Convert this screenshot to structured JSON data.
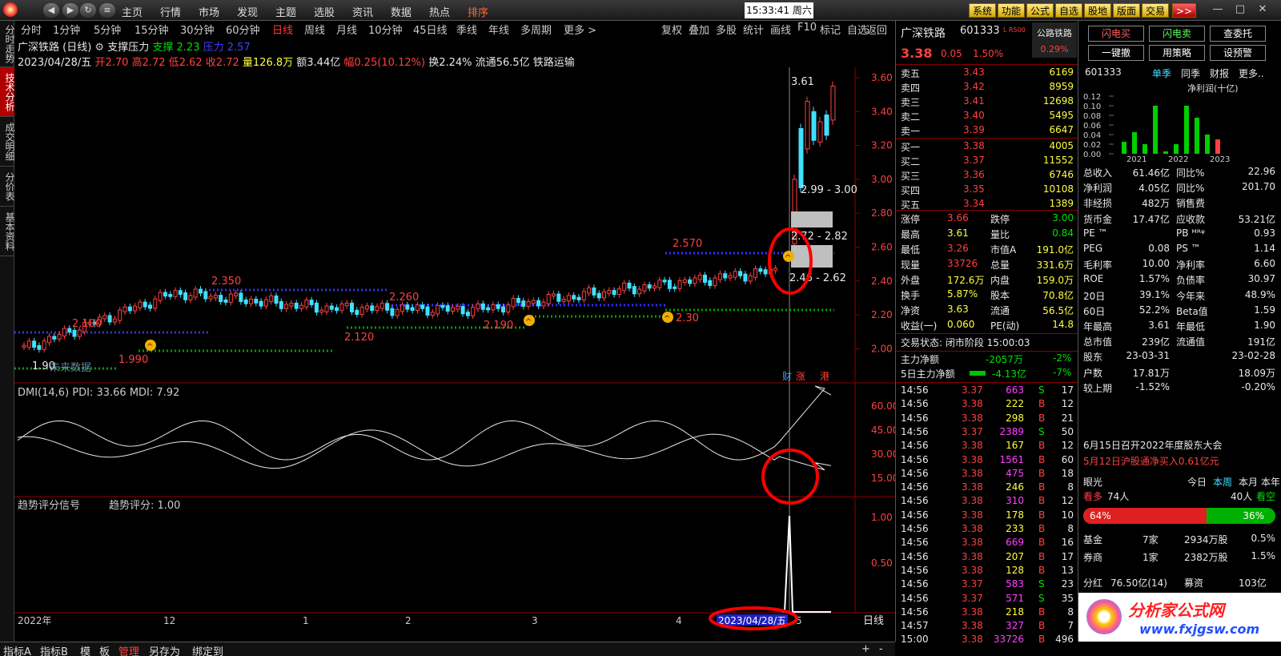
{
  "top_nav": {
    "back": "◀",
    "forward": "▶",
    "refresh": "↻",
    "menu": [
      "主页",
      "行情",
      "市场",
      "发现",
      "主题",
      "选股",
      "资讯",
      "数据",
      "热点",
      "排序"
    ],
    "active_menu": "排序",
    "clock": "15:33:41 周六",
    "right_buttons": [
      "系统",
      "功能",
      "公式",
      "自选",
      "股地",
      "版面",
      "交易"
    ],
    "more": ">>"
  },
  "left_tabs": [
    "分时走势",
    "技术分析",
    "成交明细",
    "分价表",
    "基本资料"
  ],
  "period_tabs": [
    "分时",
    "1分钟",
    "5分钟",
    "15分钟",
    "30分钟",
    "60分钟",
    "日线",
    "周线",
    "月线",
    "10分钟",
    "45日线",
    "季线",
    "年线",
    "多周期",
    "更多 >"
  ],
  "active_period": "日线",
  "chart_tools": [
    "复权",
    "叠加",
    "多股",
    "统计",
    "画线",
    "F10",
    "标记",
    "自选",
    "返回"
  ],
  "stock_title": "广深铁路 (日线)",
  "indicator_name": "支撑压力",
  "support_label": "支撑",
  "support_value": "2.23",
  "pressure_label": "压力",
  "pressure_value": "2.57",
  "info_line": {
    "date": "2023/04/28/五",
    "open_label": "开",
    "open": "2.70",
    "high_label": "高",
    "high": "2.72",
    "low_label": "低",
    "low": "2.62",
    "close_label": "收",
    "close": "2.72",
    "volume_label": "量",
    "volume": "126.8万",
    "amount_label": "额",
    "amount": "3.44亿",
    "change_label": "幅",
    "change": "0.25(10.12%)",
    "turnover_label": "换",
    "turnover": "2.24%",
    "float_label": "流通",
    "float": "56.5亿",
    "sector": "铁路运输"
  },
  "chart_annotations": {
    "price_labels": [
      "2.100",
      "1.990",
      "2.350",
      "2.120",
      "2.260",
      "2.190",
      "2.570",
      "2.30",
      "3.61"
    ],
    "zones": [
      "2.99 - 3.00",
      "2.72 - 2.82",
      "2.46 - 2.62"
    ],
    "origin_label": "1.90",
    "future_label": "未来数据",
    "event_labels": [
      "财",
      "涨",
      "港"
    ],
    "sel_date": "2023/04/28/五",
    "period_label": "日线",
    "x_ticks": [
      "2022年",
      "12",
      "1",
      "2",
      "3",
      "4",
      "5"
    ]
  },
  "price_axis": [
    "3.60",
    "3.40",
    "3.20",
    "3.00",
    "2.80",
    "2.60",
    "2.40",
    "2.20",
    "2.00"
  ],
  "dmi_title": "DMI(14,6) PDI: 33.66 MDI: 7.92",
  "dmi_axis": [
    "60.00",
    "45.00",
    "30.00",
    "15.00"
  ],
  "trend_title_a": "趋势评分信号",
  "trend_title_b": "趋势评分: 1.00",
  "trend_axis": [
    "1.00",
    "0.50"
  ],
  "chart_data": [
    {
      "type": "line",
      "title": "支撑压力 daily candlestick (close approx.)",
      "x": [
        "2022-11",
        "2022-12",
        "2023-01",
        "2023-02",
        "2023-03",
        "2023-04",
        "2023-04-28"
      ],
      "series": [
        {
          "name": "close",
          "values": [
            2.0,
            2.33,
            2.24,
            2.23,
            2.35,
            2.46,
            2.72
          ]
        }
      ],
      "ylabel": "",
      "ylim": [
        1.9,
        3.65
      ]
    },
    {
      "type": "line",
      "title": "DMI(14,6)",
      "series": [
        {
          "name": "PDI",
          "values": [
            33.66
          ]
        },
        {
          "name": "MDI",
          "values": [
            7.92
          ]
        }
      ],
      "ylim": [
        0,
        65
      ]
    },
    {
      "type": "line",
      "title": "趋势评分信号",
      "series": [
        {
          "name": "趋势评分",
          "values": [
            1.0
          ]
        }
      ],
      "ylim": [
        0,
        1.1
      ]
    }
  ],
  "quote": {
    "name": "广深铁路",
    "code": "601333",
    "tag": "L R500",
    "sector": "公路铁路",
    "sector_pct": "0.29%",
    "price": "3.38",
    "chg": "0.05",
    "pct": "1.50%",
    "asks": [
      [
        "卖五",
        "3.43",
        "6169"
      ],
      [
        "卖四",
        "3.42",
        "8959"
      ],
      [
        "卖三",
        "3.41",
        "12698"
      ],
      [
        "卖二",
        "3.40",
        "5495"
      ],
      [
        "卖一",
        "3.39",
        "6647"
      ]
    ],
    "bids": [
      [
        "买一",
        "3.38",
        "4005"
      ],
      [
        "买二",
        "3.37",
        "11552"
      ],
      [
        "买三",
        "3.36",
        "6746"
      ],
      [
        "买四",
        "3.35",
        "10108"
      ],
      [
        "买五",
        "3.34",
        "1389"
      ]
    ],
    "stats": [
      [
        "涨停",
        "3.66",
        "跌停",
        "3.00"
      ],
      [
        "最高",
        "3.61",
        "量比",
        "0.84"
      ],
      [
        "最低",
        "3.26",
        "市值A",
        "191.0亿"
      ],
      [
        "现量",
        "33726",
        "总量",
        "331.6万"
      ],
      [
        "外盘",
        "172.6万",
        "内盘",
        "159.0万"
      ],
      [
        "换手",
        "5.87%",
        "股本",
        "70.8亿"
      ],
      [
        "净资",
        "3.63",
        "流通",
        "56.5亿"
      ],
      [
        "收益(一)",
        "0.060",
        "PE(动)",
        "14.8"
      ]
    ],
    "status": "交易状态: 闭市阶段 15:00:03",
    "main_flow_label": "主力净额",
    "main_flow": "-2057万",
    "main_flow_pct": "-2%",
    "flow5_label": "5日主力净额",
    "flow5": "-4.13亿",
    "flow5_pct": "-7%",
    "ticks": [
      [
        "14:56",
        "3.37",
        "663",
        "S",
        "17"
      ],
      [
        "14:56",
        "3.38",
        "222",
        "B",
        "12"
      ],
      [
        "14:56",
        "3.38",
        "298",
        "B",
        "21"
      ],
      [
        "14:56",
        "3.37",
        "2389",
        "S",
        "50"
      ],
      [
        "14:56",
        "3.38",
        "167",
        "B",
        "12"
      ],
      [
        "14:56",
        "3.38",
        "1561",
        "B",
        "60"
      ],
      [
        "14:56",
        "3.38",
        "475",
        "B",
        "18"
      ],
      [
        "14:56",
        "3.38",
        "246",
        "B",
        "8"
      ],
      [
        "14:56",
        "3.38",
        "310",
        "B",
        "12"
      ],
      [
        "14:56",
        "3.38",
        "178",
        "B",
        "10"
      ],
      [
        "14:56",
        "3.38",
        "233",
        "B",
        "8"
      ],
      [
        "14:56",
        "3.38",
        "669",
        "B",
        "16"
      ],
      [
        "14:56",
        "3.38",
        "207",
        "B",
        "17"
      ],
      [
        "14:56",
        "3.38",
        "128",
        "B",
        "13"
      ],
      [
        "14:56",
        "3.37",
        "583",
        "S",
        "23"
      ],
      [
        "14:56",
        "3.37",
        "571",
        "S",
        "35"
      ],
      [
        "14:56",
        "3.38",
        "218",
        "B",
        "8"
      ],
      [
        "14:57",
        "3.38",
        "327",
        "B",
        "7"
      ],
      [
        "15:00",
        "3.38",
        "33726",
        "B",
        "496"
      ]
    ]
  },
  "f10": {
    "btns": [
      "闪电买",
      "闪电卖",
      "查委托",
      "一键撤",
      "用策略",
      "设预警"
    ],
    "code": "601333",
    "tabs": [
      "单季",
      "同季",
      "财报",
      "更多.."
    ],
    "chart_title": "净利润(十亿)",
    "y_ticks": [
      "0.12",
      "0.10",
      "0.08",
      "0.06",
      "0.04",
      "0.02",
      "0.00"
    ],
    "years": [
      "2021",
      "2022",
      "2023"
    ],
    "bar_values": [
      0.025,
      0.045,
      0.02,
      0.1,
      0.005,
      0.02,
      0.1,
      0.075,
      0.04,
      0.03
    ],
    "rows": [
      [
        "总收入",
        "61.46亿",
        "同比%",
        "22.96"
      ],
      [
        "净利润",
        "4.05亿",
        "同比%",
        "201.70"
      ],
      [
        "非经损",
        "482万",
        "销售费",
        ""
      ],
      [
        "货币金",
        "17.47亿",
        "应收款",
        "53.21亿"
      ],
      [
        "PE ™",
        "",
        "PB ᴹᴿᵠ",
        "0.93"
      ],
      [
        "PEG",
        "0.08",
        "PS ™",
        "1.14"
      ],
      [
        "毛利率",
        "10.00",
        "净利率",
        "6.60"
      ],
      [
        "ROE",
        "1.57%",
        "负债率",
        "30.97"
      ],
      [
        "20日",
        "39.1%",
        "今年来",
        "48.9%"
      ],
      [
        "60日",
        "52.2%",
        "Beta值",
        "1.59"
      ],
      [
        "年最高",
        "3.61",
        "年最低",
        "1.90"
      ],
      [
        "总市值",
        "239亿",
        "流通值",
        "191亿"
      ],
      [
        "股东",
        "23-03-31",
        "",
        "23-02-28"
      ],
      [
        "户数",
        "17.81万",
        "",
        "18.09万"
      ],
      [
        "较上期",
        "-1.52%",
        "",
        "-0.20%"
      ]
    ],
    "news1": "6月15日召开2022年度股东大会",
    "news2": "5月12日沪股通净买入0.61亿元",
    "eye_label": "眼光",
    "eye_tabs": [
      "今日",
      "本周",
      "本月",
      "本年"
    ],
    "bull_label": "看多",
    "bull_count": "74人",
    "bear_count": "40人",
    "bear_label": "看空",
    "bull_pct": "64%",
    "bear_pct": "36%",
    "fund_rows": [
      [
        "基金",
        "7家",
        "2934万股",
        "0.5%"
      ],
      [
        "券商",
        "1家",
        "2382万股",
        "1.5%"
      ]
    ],
    "div_label": "分红",
    "div_value": "76.50亿(14)",
    "raise_label": "募资",
    "raise_value": "103亿",
    "brand": "分析家公式网",
    "brand_url": "www.fxjgsw.com"
  },
  "bottom_tabs": [
    "指标A",
    "指标B",
    "模",
    "板",
    "管理",
    "另存为",
    "绑定到"
  ],
  "active_bottom": "管理",
  "colors": {
    "up": "#ff4040",
    "down": "#40e0ff",
    "grid": "#8b0000",
    "support": "#00c000",
    "pressure": "#3030ff"
  }
}
